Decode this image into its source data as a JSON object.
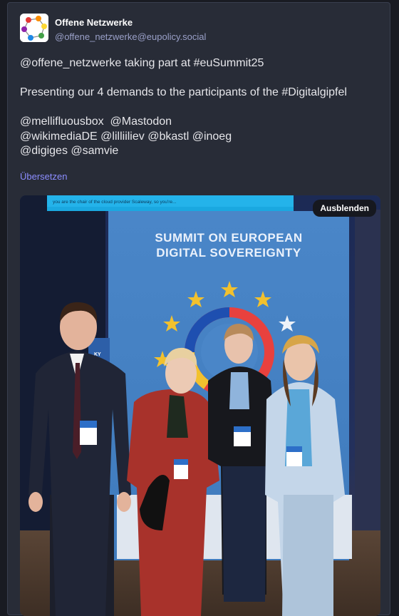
{
  "post": {
    "display_name": "Offene Netzwerke",
    "handle": "@offene_netzwerke@eupolicy.social",
    "lines": {
      "l1_mention": "@offene_netzwerke",
      "l1_text": " taking part at ",
      "l1_hashtag": "#euSummit25",
      "l2_text": "Presenting our 4 demands to the participants of the ",
      "l2_hashtag": "#Digitalgipfel",
      "l3_m1": "@mellifluousbox",
      "l3_m2": "@Mastodon",
      "l4_m1": "@wikimediaDE",
      "l4_m2": "@lilliiliev",
      "l4_m3": "@bkastl",
      "l4_m4": "@inoeg",
      "l5_m1": "@digiges",
      "l5_m2": "@samvie"
    },
    "translate_label": "Übersetzen",
    "media": {
      "hide_label": "Ausblenden",
      "screen_caption": "you are the chair of the cloud provider Scaleway, so you're...",
      "banner_line1": "SUMMIT ON EUROPEAN",
      "banner_line2": "DIGITAL SOVEREIGNTY",
      "side_banner_text": "KY"
    }
  },
  "colors": {
    "background": "#191b22",
    "card": "#282c37",
    "link_accent": "#8c8dff",
    "banner_blue": "#4a86c8",
    "eu_star": "#f2c12e"
  }
}
